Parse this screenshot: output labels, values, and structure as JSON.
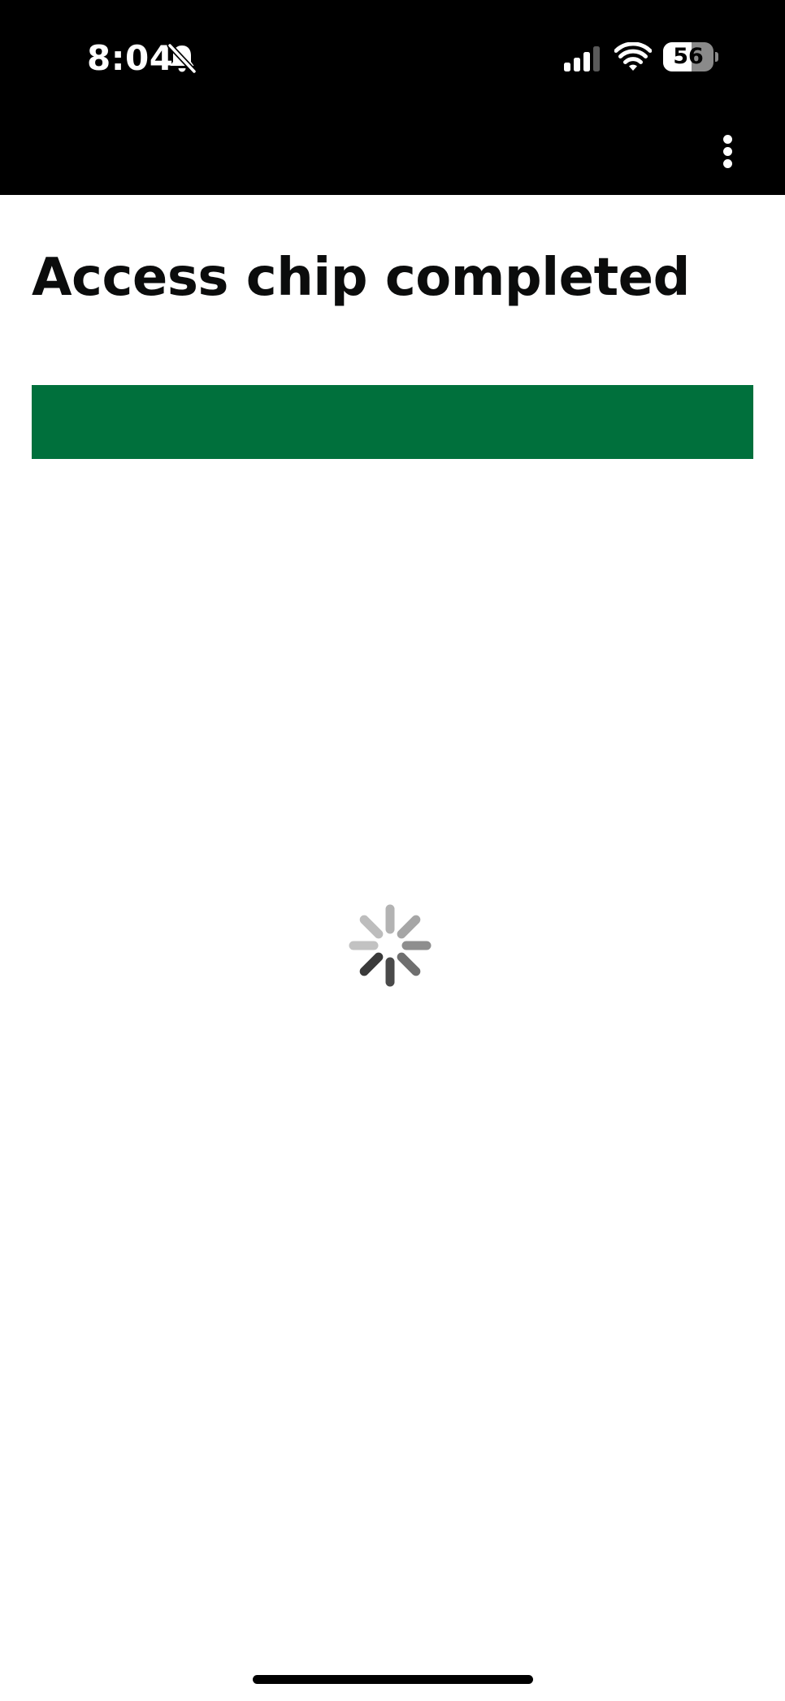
{
  "status_bar": {
    "time": "8:04",
    "battery_level": "56",
    "battery_percent": 56,
    "icons": [
      "bell-slash-icon",
      "cellular-signal-icon",
      "wifi-icon",
      "battery-icon"
    ]
  },
  "header": {
    "menu_icon": "more-vertical-icon"
  },
  "main": {
    "title": "Access chip completed",
    "progress_percent": 100,
    "spinner_icon": "loading-spinner-icon"
  },
  "colors": {
    "top_bar": "#000000",
    "progress": "#00703c",
    "background": "#ffffff",
    "title_text": "#0b0c0c"
  }
}
